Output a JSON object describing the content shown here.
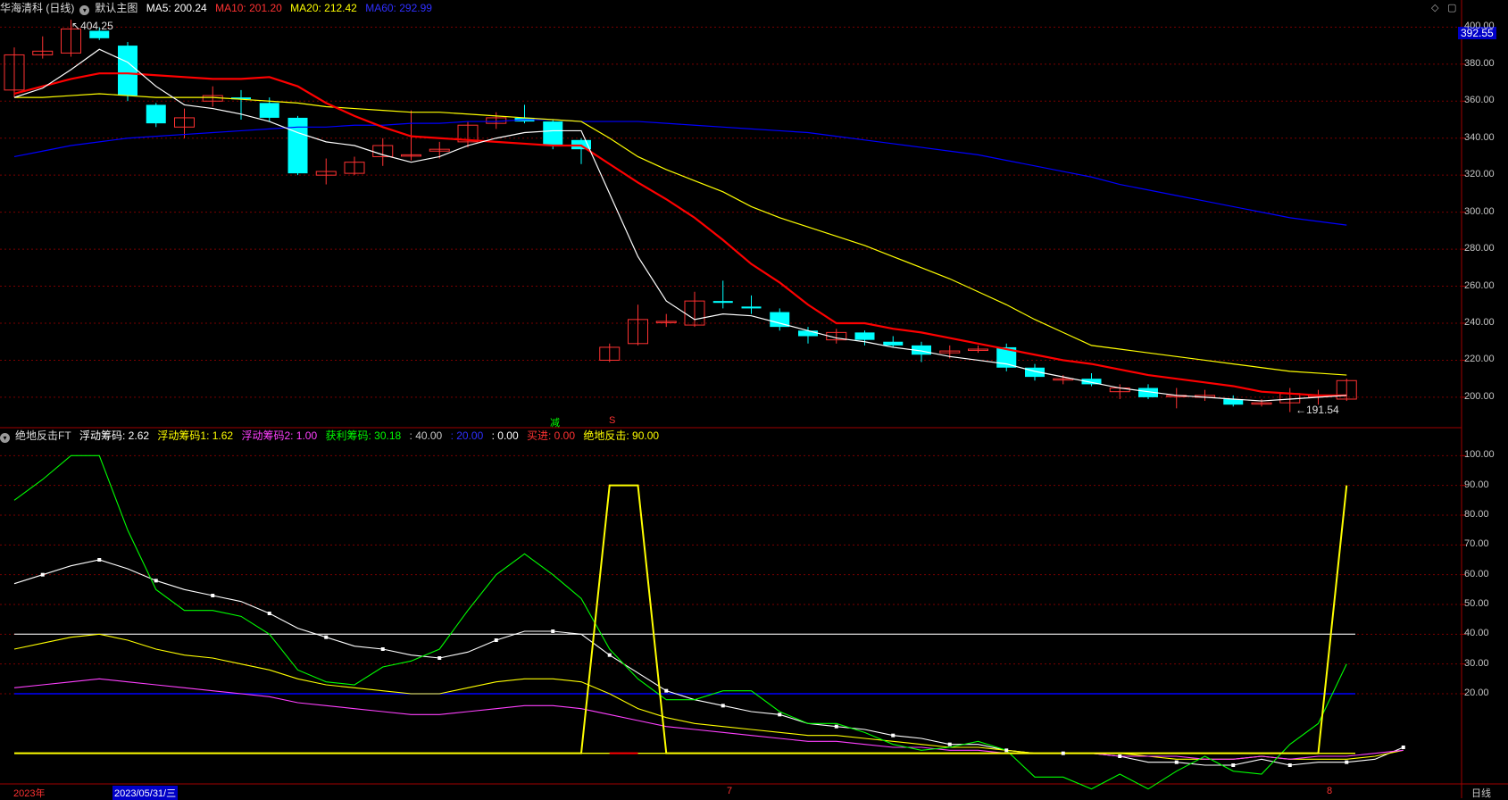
{
  "header": {
    "title": "华海清科 (日线)",
    "menu": "默认主图",
    "ma5": "MA5: 200.24",
    "ma10": "MA10: 201.20",
    "ma20": "MA20: 212.42",
    "ma60": "MA60: 292.99"
  },
  "sub_header": {
    "title": "绝地反击FT",
    "v1": "浮动筹码: 2.62",
    "v2": "浮动筹码1: 1.62",
    "v3": "浮动筹码2: 1.00",
    "v4": "获利筹码: 30.18",
    "v5": ": 40.00",
    "v6": ": 20.00",
    "v7": ": 0.00",
    "v8": "买进: 0.00",
    "v9": "绝地反击: 90.00"
  },
  "annotations": {
    "high": "404.25",
    "low": "←191.54",
    "current_price": "392.55",
    "sig1": "减",
    "sig2": "S"
  },
  "x_labels": {
    "a": "2023年",
    "b": "2023/05/31/三",
    "c": "7",
    "d": "8",
    "period": "日线"
  },
  "colors": {
    "up": "#ff3232",
    "down": "#00ffff",
    "ma5": "#ffffff",
    "ma10": "#ff0000",
    "ma20": "#ffff00",
    "ma60": "#0000ff",
    "grid": "#7a0000"
  },
  "chart_data": [
    {
      "type": "candlestick",
      "y_axis_ticks": [
        "400.00",
        "380.00",
        "360.00",
        "340.00",
        "320.00",
        "300.00",
        "280.00",
        "260.00",
        "240.00",
        "220.00",
        "200.00"
      ],
      "ylim": [
        185,
        405
      ],
      "candles": [
        {
          "o": 366,
          "c": 385,
          "h": 389,
          "l": 362
        },
        {
          "o": 385,
          "c": 387,
          "h": 395,
          "l": 383
        },
        {
          "o": 386,
          "c": 399,
          "h": 404,
          "l": 384
        },
        {
          "o": 398,
          "c": 394,
          "h": 400,
          "l": 393
        },
        {
          "o": 390,
          "c": 363,
          "h": 392,
          "l": 360
        },
        {
          "o": 358,
          "c": 348,
          "h": 359,
          "l": 346
        },
        {
          "o": 346,
          "c": 351,
          "h": 356,
          "l": 340
        },
        {
          "o": 360,
          "c": 363,
          "h": 368,
          "l": 357
        },
        {
          "o": 362,
          "c": 361,
          "h": 366,
          "l": 350
        },
        {
          "o": 359,
          "c": 351,
          "h": 362,
          "l": 349
        },
        {
          "o": 351,
          "c": 321,
          "h": 352,
          "l": 320
        },
        {
          "o": 320,
          "c": 322,
          "h": 329,
          "l": 315
        },
        {
          "o": 321,
          "c": 327,
          "h": 330,
          "l": 320
        },
        {
          "o": 330,
          "c": 336,
          "h": 340,
          "l": 325
        },
        {
          "o": 331,
          "c": 331,
          "h": 355,
          "l": 328
        },
        {
          "o": 333,
          "c": 334,
          "h": 338,
          "l": 329
        },
        {
          "o": 338,
          "c": 347,
          "h": 349,
          "l": 335
        },
        {
          "o": 348,
          "c": 351,
          "h": 354,
          "l": 345
        },
        {
          "o": 351,
          "c": 349,
          "h": 358,
          "l": 348
        },
        {
          "o": 349,
          "c": 336,
          "h": 350,
          "l": 334
        },
        {
          "o": 339,
          "c": 334,
          "h": 340,
          "l": 326
        },
        {
          "o": 220,
          "c": 227,
          "h": 229,
          "l": 219
        },
        {
          "o": 229,
          "c": 242,
          "h": 250,
          "l": 228
        },
        {
          "o": 241,
          "c": 241,
          "h": 245,
          "l": 238
        },
        {
          "o": 239,
          "c": 252,
          "h": 257,
          "l": 238
        },
        {
          "o": 252,
          "c": 251,
          "h": 263,
          "l": 248
        },
        {
          "o": 249,
          "c": 248,
          "h": 255,
          "l": 245
        },
        {
          "o": 246,
          "c": 238,
          "h": 248,
          "l": 236
        },
        {
          "o": 236,
          "c": 233,
          "h": 238,
          "l": 229
        },
        {
          "o": 231,
          "c": 235,
          "h": 237,
          "l": 229
        },
        {
          "o": 235,
          "c": 231,
          "h": 236,
          "l": 228
        },
        {
          "o": 230,
          "c": 228,
          "h": 233,
          "l": 227
        },
        {
          "o": 228,
          "c": 223,
          "h": 230,
          "l": 219
        },
        {
          "o": 224,
          "c": 225,
          "h": 228,
          "l": 221
        },
        {
          "o": 226,
          "c": 226,
          "h": 228,
          "l": 224
        },
        {
          "o": 227,
          "c": 216,
          "h": 229,
          "l": 214
        },
        {
          "o": 216,
          "c": 211,
          "h": 218,
          "l": 209
        },
        {
          "o": 210,
          "c": 210,
          "h": 212,
          "l": 207
        },
        {
          "o": 210,
          "c": 207,
          "h": 213,
          "l": 206
        },
        {
          "o": 203,
          "c": 205,
          "h": 207,
          "l": 199
        },
        {
          "o": 205,
          "c": 200,
          "h": 207,
          "l": 199
        },
        {
          "o": 201,
          "c": 201,
          "h": 205,
          "l": 194
        },
        {
          "o": 200,
          "c": 201,
          "h": 204,
          "l": 198
        },
        {
          "o": 199,
          "c": 196,
          "h": 201,
          "l": 195
        },
        {
          "o": 197,
          "c": 197,
          "h": 199,
          "l": 195
        },
        {
          "o": 197,
          "c": 202,
          "h": 205,
          "l": 192
        },
        {
          "o": 201,
          "c": 201,
          "h": 204,
          "l": 196
        },
        {
          "o": 199,
          "c": 209,
          "h": 210,
          "l": 198
        }
      ],
      "ma5": [
        362,
        367,
        377,
        388,
        381,
        368,
        358,
        356,
        353,
        349,
        343,
        338,
        336,
        331,
        327,
        330,
        336,
        340,
        343,
        344,
        344,
        310,
        276,
        252,
        242,
        245,
        244,
        240,
        236,
        232,
        230,
        227,
        225,
        222,
        220,
        218,
        214,
        211,
        208,
        205,
        203,
        201,
        200,
        199,
        198,
        199,
        200,
        201
      ],
      "ma10": [
        364,
        368,
        372,
        375,
        375,
        374,
        373,
        372,
        372,
        373,
        368,
        359,
        352,
        346,
        341,
        340,
        339,
        338,
        337,
        336,
        336,
        326,
        316,
        307,
        297,
        285,
        272,
        262,
        250,
        240,
        240,
        237,
        235,
        232,
        229,
        226,
        223,
        220,
        218,
        215,
        212,
        210,
        208,
        206,
        203,
        202,
        201,
        201
      ],
      "ma20": [
        362,
        362,
        363,
        364,
        363,
        362,
        362,
        362,
        361,
        360,
        359,
        357,
        356,
        355,
        354,
        354,
        353,
        352,
        351,
        350,
        349,
        340,
        330,
        323,
        317,
        311,
        303,
        297,
        292,
        287,
        282,
        276,
        270,
        264,
        257,
        250,
        242,
        235,
        228,
        226,
        224,
        222,
        220,
        218,
        216,
        214,
        213,
        212
      ],
      "ma60": [
        330,
        333,
        336,
        338,
        340,
        341,
        342,
        343,
        344,
        345,
        346,
        346,
        347,
        347,
        348,
        348,
        349,
        349,
        350,
        350,
        349,
        349,
        349,
        348,
        347,
        346,
        345,
        344,
        343,
        341,
        339,
        337,
        335,
        333,
        331,
        328,
        325,
        322,
        319,
        315,
        312,
        309,
        306,
        303,
        300,
        297,
        295,
        293
      ]
    },
    {
      "type": "line",
      "y_axis_ticks": [
        "100.00",
        "90.00",
        "80.00",
        "70.00",
        "60.00",
        "50.00",
        "40.00",
        "30.00",
        "20.00"
      ],
      "ylim": [
        -10,
        104
      ],
      "hlines": [
        40,
        20,
        0
      ],
      "series": [
        {
          "name": "浮动筹码",
          "values": [
            57,
            60,
            63,
            65,
            62,
            58,
            55,
            53,
            51,
            47,
            42,
            39,
            36,
            35,
            33,
            32,
            34,
            38,
            41,
            41,
            40,
            33,
            27,
            21,
            18,
            16,
            14,
            13,
            10,
            9,
            8,
            6,
            5,
            3,
            3,
            1,
            0,
            0,
            0,
            -1,
            -3,
            -3,
            -4,
            -4,
            -2,
            -4,
            -3,
            -3,
            -2,
            2
          ]
        },
        {
          "name": "浮动筹码1",
          "values": [
            35,
            37,
            39,
            40,
            38,
            35,
            33,
            32,
            30,
            28,
            25,
            23,
            22,
            21,
            20,
            20,
            22,
            24,
            25,
            25,
            24,
            20,
            15,
            12,
            10,
            9,
            8,
            7,
            6,
            6,
            5,
            4,
            3,
            2,
            2,
            1,
            0,
            0,
            0,
            0,
            -1,
            -2,
            -2,
            -2,
            -1,
            -2,
            -2,
            -2,
            -1,
            1
          ]
        },
        {
          "name": "浮动筹码2",
          "values": [
            22,
            23,
            24,
            25,
            24,
            23,
            22,
            21,
            20,
            19,
            17,
            16,
            15,
            14,
            13,
            13,
            14,
            15,
            16,
            16,
            15,
            13,
            11,
            9,
            8,
            7,
            6,
            5,
            4,
            4,
            3,
            2,
            2,
            1,
            1,
            0,
            0,
            0,
            0,
            -1,
            -1,
            -1,
            -2,
            -2,
            -1,
            -2,
            -1,
            -1,
            0,
            1
          ]
        },
        {
          "name": "获利筹码",
          "values": [
            85,
            92,
            100,
            100,
            75,
            55,
            48,
            48,
            46,
            40,
            28,
            24,
            23,
            29,
            31,
            35,
            48,
            60,
            67,
            60,
            52,
            35,
            25,
            18,
            18,
            21,
            21,
            14,
            10,
            10,
            7,
            3,
            1,
            2,
            4,
            1,
            -8,
            -8,
            -12,
            -7,
            -12,
            -6,
            -1,
            -6,
            -7,
            3,
            10,
            30
          ]
        },
        {
          "name": "绝地反击",
          "values": [
            0,
            0,
            0,
            0,
            0,
            0,
            0,
            0,
            0,
            0,
            0,
            0,
            0,
            0,
            0,
            0,
            0,
            0,
            0,
            0,
            0,
            90,
            90,
            0,
            0,
            0,
            0,
            0,
            0,
            0,
            0,
            0,
            0,
            0,
            0,
            0,
            0,
            0,
            0,
            0,
            0,
            0,
            0,
            0,
            0,
            0,
            0,
            90
          ]
        }
      ]
    }
  ]
}
